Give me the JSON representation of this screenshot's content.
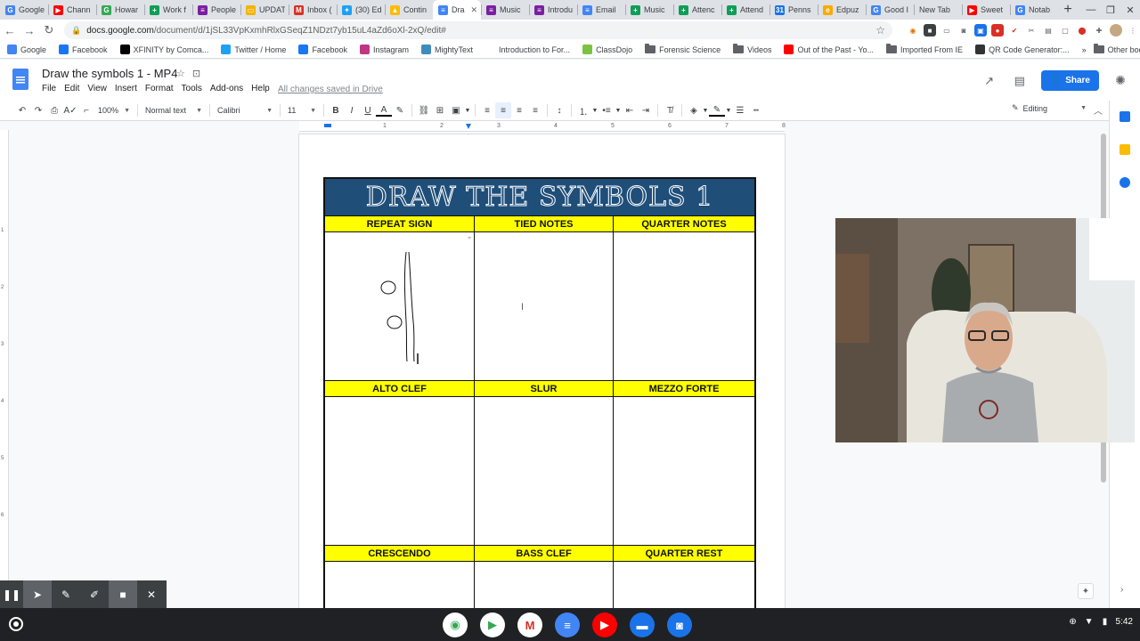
{
  "browser": {
    "tabs": [
      {
        "label": "Google",
        "icon": "google-icon",
        "color": "#4285f4",
        "glyph": "G"
      },
      {
        "label": "Chann",
        "icon": "youtube-icon",
        "color": "#ff0000",
        "glyph": "▶"
      },
      {
        "label": "Howar",
        "icon": "google-icon",
        "color": "#34a853",
        "glyph": "G"
      },
      {
        "label": "Work f",
        "icon": "sheets-icon",
        "color": "#0f9d58",
        "glyph": "+"
      },
      {
        "label": "People",
        "icon": "forms-icon",
        "color": "#7b1fa2",
        "glyph": "≡"
      },
      {
        "label": "UPDAT",
        "icon": "slides-icon",
        "color": "#f4b400",
        "glyph": "▭"
      },
      {
        "label": "Inbox (",
        "icon": "gmail-icon",
        "color": "#d93025",
        "glyph": "M"
      },
      {
        "label": "(30) Ed",
        "icon": "twitter-icon",
        "color": "#1da1f2",
        "glyph": "✦"
      },
      {
        "label": "Contin",
        "icon": "drive-icon",
        "color": "#fbbc04",
        "glyph": "▲"
      },
      {
        "label": "Dra",
        "icon": "docs-icon",
        "color": "#4285f4",
        "glyph": "≡",
        "active": true
      },
      {
        "label": "Music",
        "icon": "forms-icon",
        "color": "#7b1fa2",
        "glyph": "≡"
      },
      {
        "label": "Introdu",
        "icon": "forms-icon",
        "color": "#7b1fa2",
        "glyph": "≡"
      },
      {
        "label": "Email",
        "icon": "docs-icon",
        "color": "#4285f4",
        "glyph": "≡"
      },
      {
        "label": "Music",
        "icon": "sheets-icon",
        "color": "#0f9d58",
        "glyph": "+"
      },
      {
        "label": "Attenc",
        "icon": "sheets-icon",
        "color": "#0f9d58",
        "glyph": "+"
      },
      {
        "label": "Attend",
        "icon": "sheets-icon",
        "color": "#0f9d58",
        "glyph": "+"
      },
      {
        "label": "Penns",
        "icon": "calendar-icon",
        "color": "#1a73e8",
        "glyph": "31"
      },
      {
        "label": "Edpuz",
        "icon": "edpuzzle-icon",
        "color": "#f9ab00",
        "glyph": "e"
      },
      {
        "label": "Good I",
        "icon": "google-icon",
        "color": "#4285f4",
        "glyph": "G"
      },
      {
        "label": "New Tab",
        "icon": "",
        "color": "",
        "glyph": ""
      },
      {
        "label": "Sweet",
        "icon": "youtube-icon",
        "color": "#ff0000",
        "glyph": "▶"
      },
      {
        "label": "Notab",
        "icon": "google-icon",
        "color": "#4285f4",
        "glyph": "G"
      }
    ],
    "active_tab_close": "✕",
    "new_tab": "+",
    "url_host": "docs.google.com",
    "url_path": "/document/d/1jSL33VpKxmhRlxGSeqZ1NDzt7yb15uL4aZd6oXl-2xQ/edit#"
  },
  "bookmarks": [
    {
      "label": "Google",
      "icon": "google-icon"
    },
    {
      "label": "Facebook",
      "icon": "facebook-icon"
    },
    {
      "label": "XFINITY by Comca...",
      "icon": "xfinity-icon"
    },
    {
      "label": "Twitter / Home",
      "icon": "twitter-icon"
    },
    {
      "label": "Facebook",
      "icon": "facebook-icon"
    },
    {
      "label": "Instagram",
      "icon": "instagram-icon"
    },
    {
      "label": "MightyText",
      "icon": "mightytext-icon"
    },
    {
      "label": "Introduction to For...",
      "icon": "page-icon"
    },
    {
      "label": "ClassDojo",
      "icon": "classdojo-icon"
    },
    {
      "label": "Forensic Science",
      "icon": "folder-icon"
    },
    {
      "label": "Videos",
      "icon": "folder-icon"
    },
    {
      "label": "Out of the Past - Yo...",
      "icon": "youtube-icon"
    },
    {
      "label": "Imported From IE",
      "icon": "folder-icon"
    },
    {
      "label": "QR Code Generator:...",
      "icon": "qr-icon"
    }
  ],
  "bookmarks_other": "Other bookmarks",
  "docs": {
    "title": "Draw the symbols 1 - MP4",
    "menu": [
      "File",
      "Edit",
      "View",
      "Insert",
      "Format",
      "Tools",
      "Add-ons",
      "Help"
    ],
    "save_status": "All changes saved in Drive",
    "share_label": "Share",
    "toolbar": {
      "zoom": "100%",
      "style": "Normal text",
      "font": "Calibri",
      "size": "11",
      "bold": "B",
      "italic": "I",
      "underline": "U",
      "text_color": "A"
    },
    "mode": "Editing",
    "ruler_ticks": [
      "1",
      "2",
      "3",
      "4",
      "5",
      "6",
      "7",
      "8"
    ],
    "vruler_ticks": [
      "1",
      "2",
      "3",
      "4",
      "5",
      "6"
    ]
  },
  "worksheet": {
    "banner": "DRAW THE SYMBOLS 1",
    "rows": [
      [
        "REPEAT SIGN",
        "TIED NOTES",
        "QUARTER NOTES"
      ],
      [
        "ALTO CLEF",
        "SLUR",
        "MEZZO FORTE"
      ],
      [
        "CRESCENDO",
        "BASS CLEF",
        "QUARTER REST"
      ]
    ]
  },
  "shelf": {
    "apps": [
      {
        "name": "chrome-icon",
        "color": "#fff"
      },
      {
        "name": "play-store-icon",
        "color": "#fff"
      },
      {
        "name": "gmail-icon",
        "color": "#fff"
      },
      {
        "name": "docs-icon",
        "color": "#4285f4"
      },
      {
        "name": "youtube-icon",
        "color": "#ff0000"
      },
      {
        "name": "messages-icon",
        "color": "#1a73e8"
      },
      {
        "name": "camera-icon",
        "color": "#1a73e8"
      }
    ],
    "time": "5:42"
  }
}
